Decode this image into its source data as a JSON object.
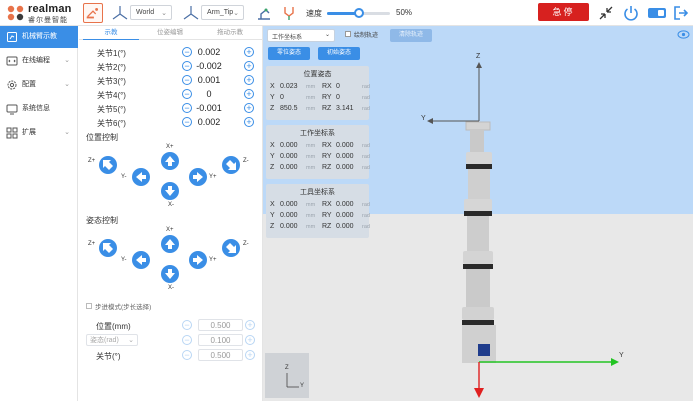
{
  "brand": {
    "name": "realman",
    "subtitle": "睿尔曼智能"
  },
  "toolbar": {
    "frame_select": "World",
    "tool_select": "Arm_Tip",
    "speed_label": "速度",
    "speed_value": "50%",
    "speed_percent": 50,
    "estop_label": "急停"
  },
  "sidebar": {
    "items": [
      {
        "label": "机械臂示教",
        "icon": "robot-arm-icon",
        "active": true
      },
      {
        "label": "在线编程",
        "icon": "code-icon",
        "active": false
      },
      {
        "label": "配置",
        "icon": "gear-icon",
        "active": false
      },
      {
        "label": "系统信息",
        "icon": "monitor-icon",
        "active": false
      },
      {
        "label": "扩展",
        "icon": "extension-icon",
        "active": false
      }
    ]
  },
  "panel": {
    "tabs": [
      "示教",
      "位姿编辑",
      "拖动示教"
    ],
    "joints": [
      {
        "label": "关节1(°)",
        "value": "0.002"
      },
      {
        "label": "关节2(°)",
        "value": "-0.002"
      },
      {
        "label": "关节3(°)",
        "value": "0.001"
      },
      {
        "label": "关节4(°)",
        "value": "0"
      },
      {
        "label": "关节5(°)",
        "value": "-0.001"
      },
      {
        "label": "关节6(°)",
        "value": "0.002"
      }
    ],
    "position_control_title": "位置控制",
    "position_labels": {
      "z_plus": "Z+",
      "y_minus": "Y-",
      "x_plus": "X+",
      "x_minus": "X-",
      "y_plus": "Y+",
      "z_minus": "Z-"
    },
    "attitude_control_title": "姿态控制",
    "attitude_labels": {
      "z_plus": "Z+",
      "y_minus": "Y-",
      "x_plus": "X+",
      "x_minus": "X-",
      "y_plus": "Y+",
      "z_minus": "Z-"
    },
    "step_mode_label": "步进模式(步长选择)",
    "step_rows": [
      {
        "label": "位置(mm)",
        "value": "0.500"
      },
      {
        "label": "",
        "value": "0.100"
      },
      {
        "label": "关节(°)",
        "value": "0.500"
      }
    ],
    "attitude_unit": "姿态(rad)"
  },
  "viewer": {
    "coord_select": "工作坐标系",
    "trajectory_label": "绘制轨迹",
    "clear_label": "清除轨迹",
    "pose_buttons": [
      "零位姿态",
      "初始姿态"
    ],
    "boxes": [
      {
        "title": "位置姿态",
        "rows": [
          [
            "X",
            "0.023",
            "mm",
            "RX",
            "0",
            "rad"
          ],
          [
            "Y",
            "0",
            "mm",
            "RY",
            "0",
            "rad"
          ],
          [
            "Z",
            "850.5",
            "mm",
            "RZ",
            "3.141",
            "rad"
          ]
        ]
      },
      {
        "title": "工作坐标系",
        "rows": [
          [
            "X",
            "0.000",
            "mm",
            "RX",
            "0.000",
            "rad"
          ],
          [
            "Y",
            "0.000",
            "mm",
            "RY",
            "0.000",
            "rad"
          ],
          [
            "Z",
            "0.000",
            "mm",
            "RZ",
            "0.000",
            "rad"
          ]
        ]
      },
      {
        "title": "工具坐标系",
        "rows": [
          [
            "X",
            "0.000",
            "mm",
            "RX",
            "0.000",
            "rad"
          ],
          [
            "Y",
            "0.000",
            "mm",
            "RY",
            "0.000",
            "rad"
          ],
          [
            "Z",
            "0.000",
            "mm",
            "RZ",
            "0.000",
            "rad"
          ]
        ]
      }
    ],
    "axis_labels": {
      "z_tip": "Z",
      "y_tip": "Y",
      "z_base": "Z",
      "y_base": "Y"
    },
    "colors": {
      "accent": "#3a8ee6",
      "estop": "#d7211f",
      "sky": "#bcd9f8"
    }
  }
}
